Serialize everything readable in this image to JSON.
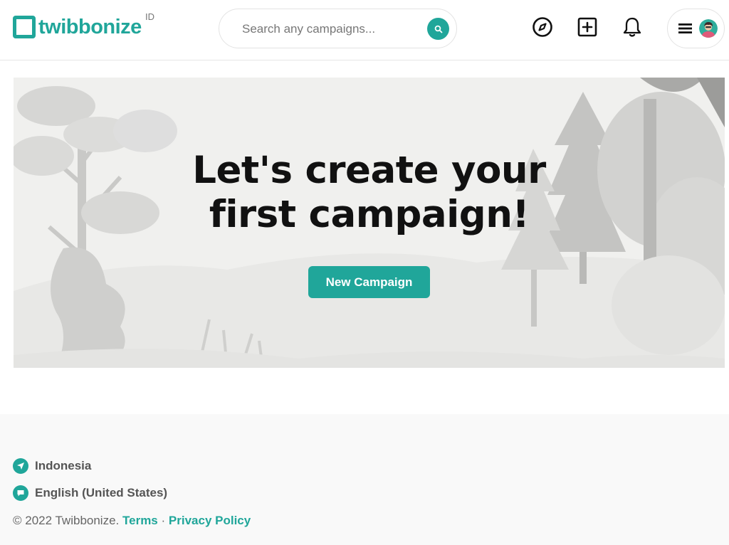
{
  "header": {
    "logo_text": "twibbonize",
    "logo_region": "ID",
    "search_placeholder": "Search any campaigns...",
    "icons": [
      "compass-icon",
      "plus-square-icon",
      "bell-icon",
      "menu-icon",
      "avatar"
    ]
  },
  "hero": {
    "title_line1": "Let's create your",
    "title_line2": "first campaign!",
    "button_label": "New Campaign"
  },
  "footer": {
    "country": "Indonesia",
    "language": "English (United States)",
    "copyright": "© 2022 Twibbonize.",
    "terms": "Terms",
    "separator": "·",
    "privacy": "Privacy Policy"
  },
  "colors": {
    "accent": "#20a69a",
    "text_dark": "#111111",
    "footer_bg": "#f9f9f9",
    "hero_bg": "#f0f0ee"
  }
}
